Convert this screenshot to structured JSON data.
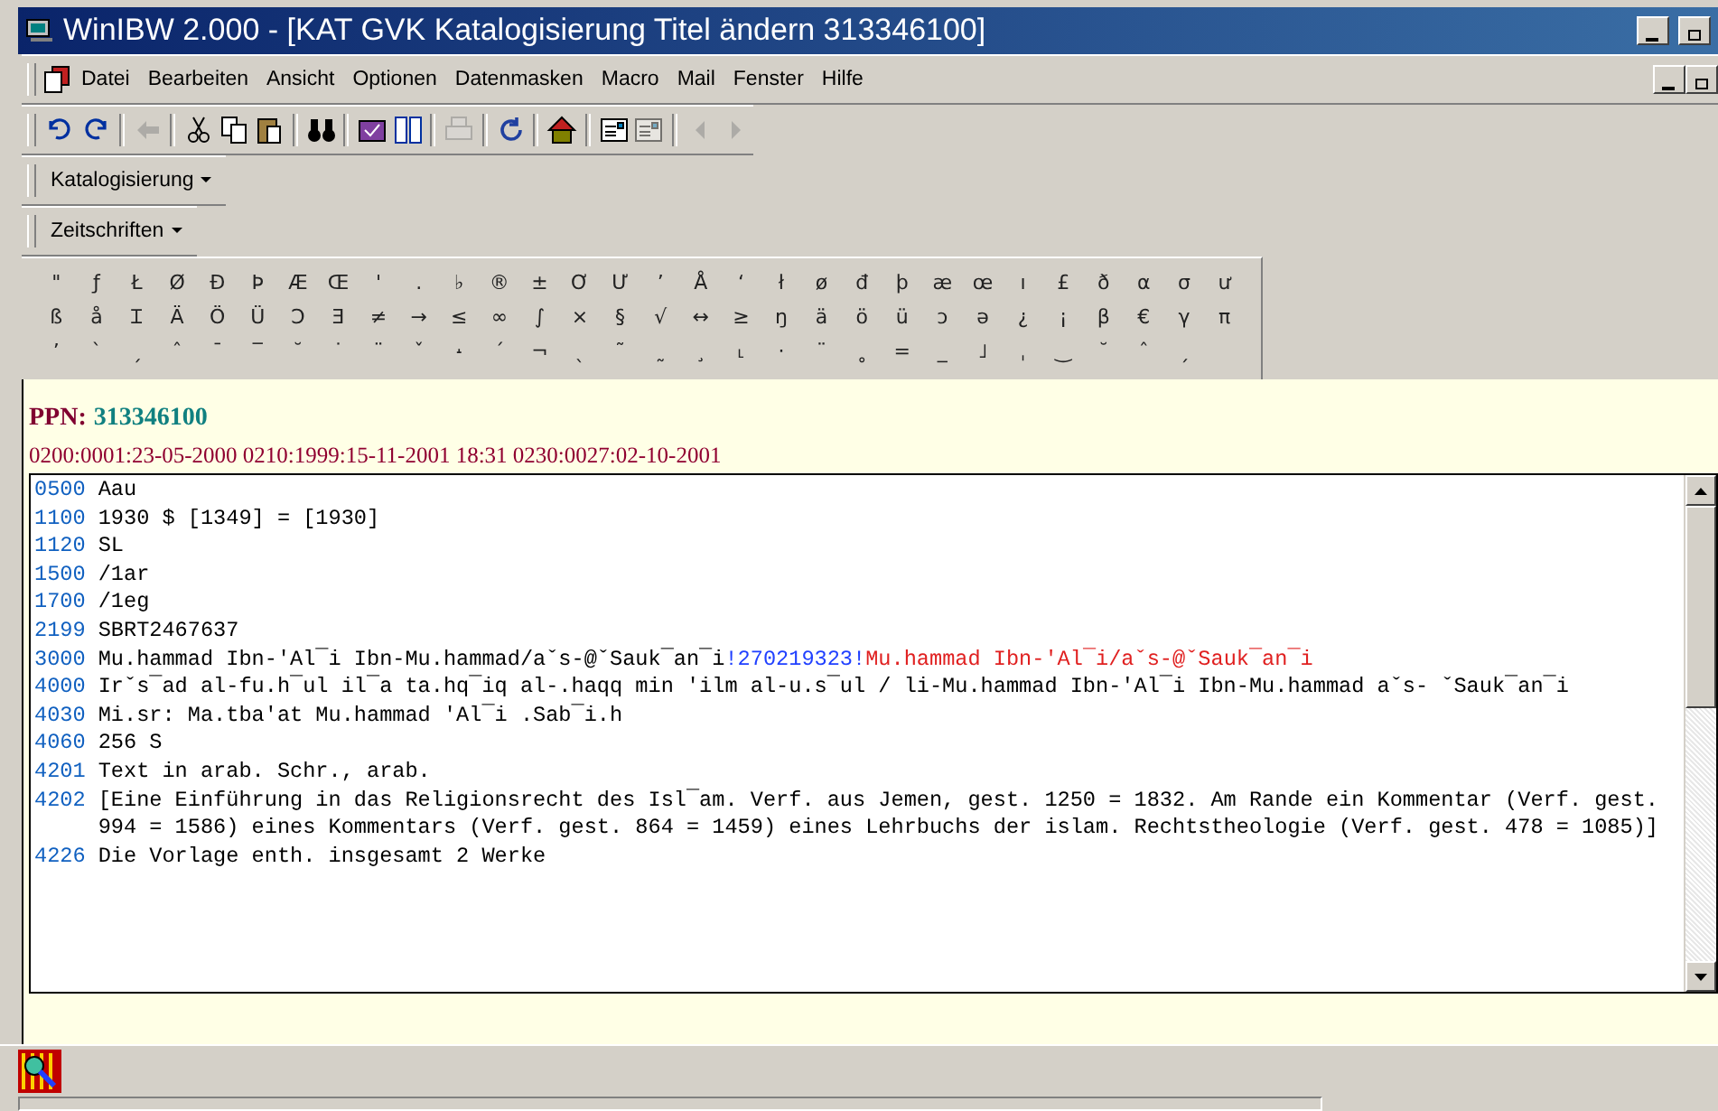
{
  "window": {
    "title": "WinIBW 2.000 - [KAT GVK Katalogisierung Titel ändern 313346100]"
  },
  "menu": [
    "Datei",
    "Bearbeiten",
    "Ansicht",
    "Optionen",
    "Datenmasken",
    "Macro",
    "Mail",
    "Fenster",
    "Hilfe"
  ],
  "toolbar": [
    {
      "kind": "button",
      "disabled": false
    },
    {
      "kind": "button",
      "disabled": false
    },
    {
      "kind": "sep"
    },
    {
      "kind": "button",
      "disabled": true
    },
    {
      "kind": "sep"
    },
    {
      "kind": "button",
      "disabled": false
    },
    {
      "kind": "button",
      "disabled": false
    },
    {
      "kind": "button",
      "disabled": false
    },
    {
      "kind": "sep"
    },
    {
      "kind": "button",
      "disabled": false
    },
    {
      "kind": "sep"
    },
    {
      "kind": "button",
      "disabled": false
    },
    {
      "kind": "button",
      "disabled": false
    },
    {
      "kind": "sep"
    },
    {
      "kind": "button",
      "disabled": true
    },
    {
      "kind": "sep"
    },
    {
      "kind": "button",
      "disabled": false
    },
    {
      "kind": "sep"
    },
    {
      "kind": "button",
      "disabled": false
    },
    {
      "kind": "sep"
    },
    {
      "kind": "button",
      "disabled": false
    },
    {
      "kind": "button",
      "disabled": true
    },
    {
      "kind": "sep"
    },
    {
      "kind": "button",
      "disabled": true
    },
    {
      "kind": "button",
      "disabled": true
    }
  ],
  "dropdown_bars": [
    "Katalogisierung",
    "Zeitschriften"
  ],
  "special_characters": [
    [
      "\"",
      "ƒ",
      "Ł",
      "Ø",
      "Đ",
      "Þ",
      "Æ",
      "Œ",
      "'",
      ".",
      "♭",
      "®",
      "±",
      "Ơ",
      "Ư",
      "ʼ",
      "Å",
      "ʻ",
      "ł",
      "ø",
      "đ",
      "þ",
      "æ",
      "œ",
      "ı",
      "£",
      "ð",
      "α",
      "σ",
      "ư"
    ],
    [
      "ß",
      "å",
      "Ɪ",
      "Ä",
      "Ö",
      "Ü",
      "Ɔ",
      "Ǝ",
      "≠",
      "→",
      "≤",
      "∞",
      "∫",
      "×",
      "§",
      "√",
      "↔",
      "≥",
      "ŋ",
      "ä",
      "ö",
      "ü",
      "ɔ",
      "ə",
      "¿",
      "¡",
      "β",
      "€",
      "γ",
      "π"
    ],
    [
      "ʼ",
      "ˋ",
      "ˏ",
      "ˆ",
      "ˉ",
      "‾",
      "˘",
      "˙",
      "¨",
      "ˇ",
      "˔",
      "ˊ",
      "¬",
      "ˎ",
      "˜",
      "˷",
      "¸",
      "˪",
      "·",
      "¨",
      "˳",
      "=",
      "_",
      "˩",
      "ˌ",
      "‿",
      "˘",
      "ˆ",
      "ˏ"
    ]
  ],
  "record": {
    "ppn_label": "PPN:",
    "ppn": "313346100",
    "dates": "0200:0001:23-05-2000 0210:1999:15-11-2001 18:31 0230:0027:02-10-2001",
    "lines": [
      {
        "tag": "0500",
        "segments": [
          {
            "kind": "plain",
            "text": "Aau"
          }
        ]
      },
      {
        "tag": "1100",
        "segments": [
          {
            "kind": "plain",
            "text": "1930 $ [1349] = [1930]"
          }
        ]
      },
      {
        "tag": "1120",
        "segments": [
          {
            "kind": "plain",
            "text": "SL"
          }
        ]
      },
      {
        "tag": "1500",
        "segments": [
          {
            "kind": "plain",
            "text": "/1ar"
          }
        ]
      },
      {
        "tag": "1700",
        "segments": [
          {
            "kind": "plain",
            "text": "/1eg"
          }
        ]
      },
      {
        "tag": "2199",
        "segments": [
          {
            "kind": "plain",
            "text": "SBRT2467637"
          }
        ]
      },
      {
        "tag": "3000",
        "segments": [
          {
            "kind": "plain",
            "text": "Mu.hammad Ibn-'Al¯i Ibn-Mu.hammad/aˇs-@ˇSauk¯an¯i"
          },
          {
            "kind": "link",
            "text": "!270219323!"
          },
          {
            "kind": "linked",
            "text": "Mu.hammad Ibn-'Al¯i/aˇs-@ˇSauk¯an¯i"
          }
        ]
      },
      {
        "tag": "4000",
        "segments": [
          {
            "kind": "plain",
            "text": "Irˇs¯ad al-fu.h¯ul il¯a ta.hq¯iq al-.haqq min 'ilm al-u.s¯ul / li-Mu.hammad Ibn-'Al¯i Ibn-Mu.hammad aˇs- ˇSauk¯an¯i"
          }
        ]
      },
      {
        "tag": "4030",
        "segments": [
          {
            "kind": "plain",
            "text": "Mi.sr: Ma.tba'at Mu.hammad 'Al¯i .Sab¯i.h"
          }
        ]
      },
      {
        "tag": "4060",
        "segments": [
          {
            "kind": "plain",
            "text": "256 S"
          }
        ]
      },
      {
        "tag": "4201",
        "segments": [
          {
            "kind": "plain",
            "text": "Text in arab. Schr., arab."
          }
        ]
      },
      {
        "tag": "4202",
        "segments": [
          {
            "kind": "plain",
            "text": "[Eine Einführung in das Religionsrecht des Isl¯am. Verf. aus Jemen, gest. 1250 = 1832. Am Rande ein Kommentar (Verf. gest. 994 = 1586) eines Kommentars (Verf. gest. 864 = 1459) eines Lehrbuchs der islam. Rechtstheologie (Verf. gest. 478 = 1085)]"
          }
        ]
      },
      {
        "tag": "4226",
        "segments": [
          {
            "kind": "plain",
            "text": "Die Vorlage enth. insgesamt 2 Werke"
          }
        ]
      }
    ]
  }
}
